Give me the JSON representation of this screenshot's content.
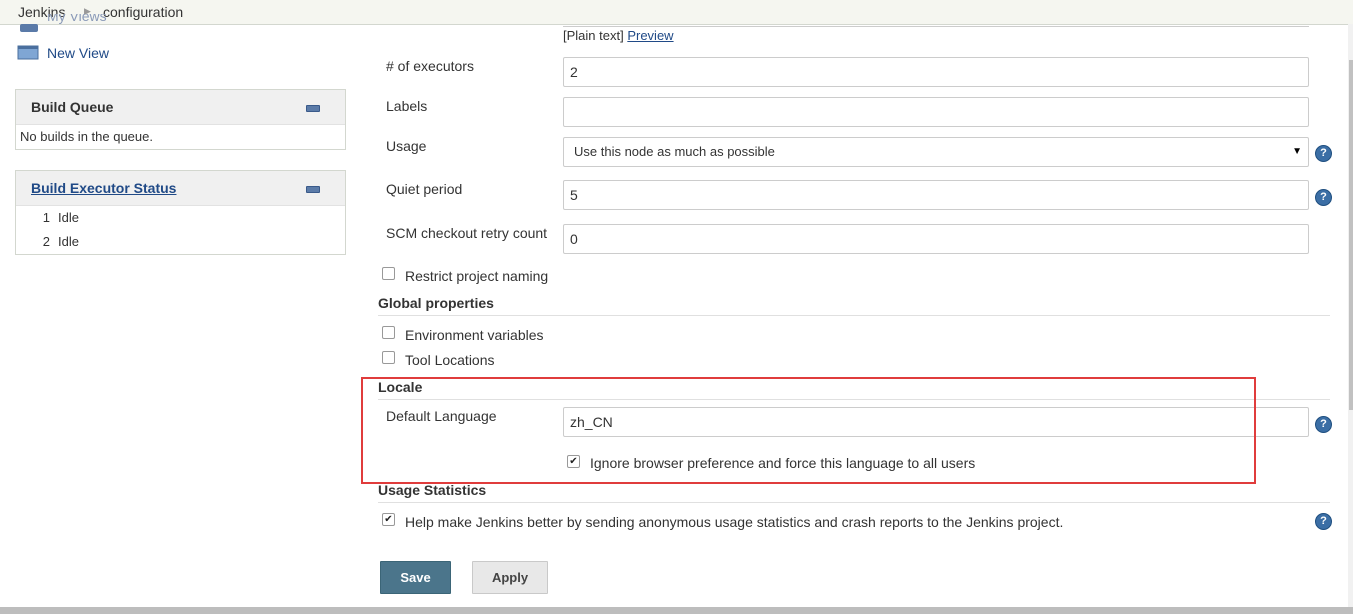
{
  "breadcrumb": {
    "items": [
      "Jenkins",
      "configuration"
    ]
  },
  "sidebar": {
    "partial_item": "My Views",
    "new_view": "New View",
    "build_queue": {
      "title": "Build Queue",
      "empty": "No builds in the queue."
    },
    "executors": {
      "title": "Build Executor Status",
      "rows": [
        {
          "num": "1",
          "status": "Idle"
        },
        {
          "num": "2",
          "status": "Idle"
        }
      ]
    }
  },
  "form": {
    "plain_text": "[Plain text]",
    "preview": "Preview",
    "executors": {
      "label": "# of executors",
      "value": "2"
    },
    "labels": {
      "label": "Labels",
      "value": ""
    },
    "usage": {
      "label": "Usage",
      "value": "Use this node as much as possible"
    },
    "quiet_period": {
      "label": "Quiet period",
      "value": "5"
    },
    "scm_retry": {
      "label": "SCM checkout retry count",
      "value": "0"
    },
    "restrict_naming": {
      "label": "Restrict project naming",
      "checked": false
    },
    "global_properties": {
      "title": "Global properties",
      "env_vars": {
        "label": "Environment variables",
        "checked": false
      },
      "tool_locations": {
        "label": "Tool Locations",
        "checked": false
      }
    },
    "locale": {
      "title": "Locale",
      "default_language": {
        "label": "Default Language",
        "value": "zh_CN"
      },
      "ignore_browser": {
        "label": "Ignore browser preference and force this language to all users",
        "checked": true
      }
    },
    "usage_stats": {
      "title": "Usage Statistics",
      "help_jenkins": {
        "label": "Help make Jenkins better by sending anonymous usage statistics and crash reports to the Jenkins project.",
        "checked": true
      }
    }
  },
  "buttons": {
    "save": "Save",
    "apply": "Apply"
  },
  "icons": {
    "help": "?",
    "check": "✔",
    "select_arrow": "▼"
  },
  "colors": {
    "save_bg": "#4b758b",
    "highlight_border": "#e03c3c",
    "link": "#204a87"
  }
}
